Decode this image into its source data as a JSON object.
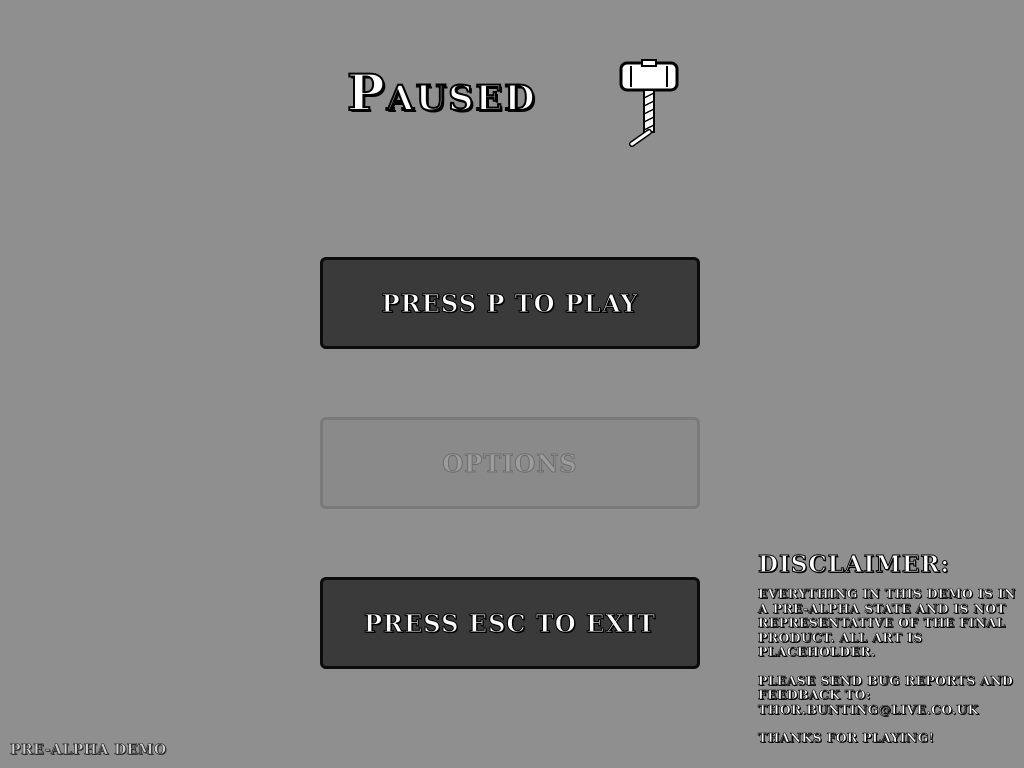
{
  "menu": {
    "title": "Paused",
    "icon": "hammer-icon",
    "buttons": {
      "play": "Press P to Play",
      "options": "Options",
      "exit": "Press ESC to Exit"
    }
  },
  "disclaimer": {
    "heading": "Disclaimer:",
    "body": "Everything in this demo is in a pre-alpha state and is not representative of the final product. All art is placeholder.",
    "feedback": "Please send bug reports and feedback to: thor.bunting@live.co.uk",
    "thanks": "Thanks for playing!"
  },
  "footer": {
    "label": "Pre-Alpha Demo"
  },
  "colors": {
    "background": "#8f8f8f",
    "button_active": "#3a3a3a",
    "button_disabled": "#8a8a8a",
    "text": "#ffffff"
  }
}
